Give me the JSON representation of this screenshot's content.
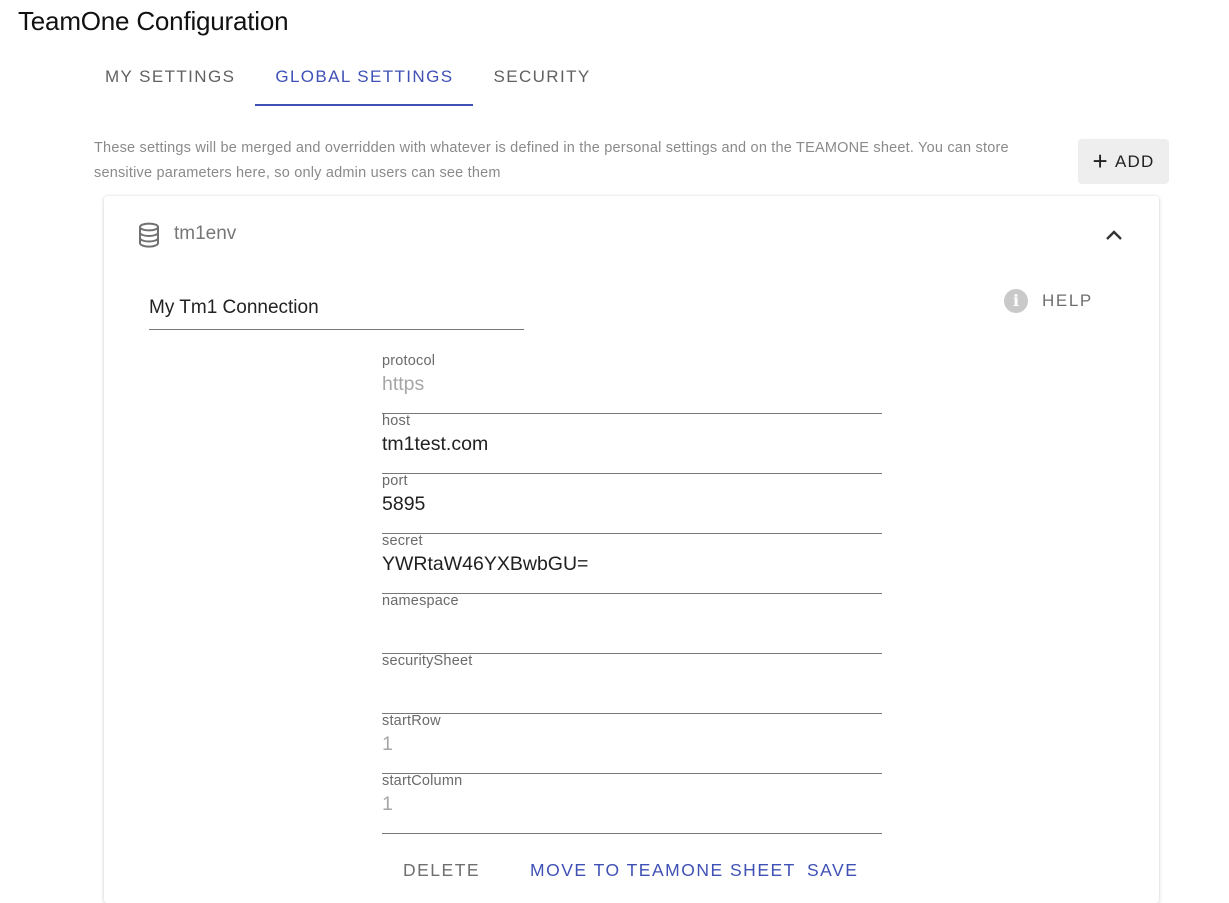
{
  "app": {
    "title": "TeamOne Configuration"
  },
  "tabs": [
    {
      "label": "MY SETTINGS",
      "active": false
    },
    {
      "label": "GLOBAL SETTINGS",
      "active": true
    },
    {
      "label": "SECURITY",
      "active": false
    }
  ],
  "description": "These settings will be merged and overridden with whatever is defined in the personal settings and on the TEAMONE sheet. You can store sensitive parameters here, so only admin users can see them",
  "toolbar": {
    "add_label": "ADD",
    "add_icon": "plus-icon"
  },
  "card": {
    "icon": "database-icon",
    "title": "tm1env",
    "expanded": true,
    "name_value": "My Tm1 Connection",
    "help_label": "HELP",
    "fields": [
      {
        "label": "protocol",
        "value": "https",
        "is_placeholder": true
      },
      {
        "label": "host",
        "value": "tm1test.com",
        "is_placeholder": false
      },
      {
        "label": "port",
        "value": "5895",
        "is_placeholder": false
      },
      {
        "label": "secret",
        "value": "YWRtaW46YXBwbGU=",
        "is_placeholder": false
      },
      {
        "label": "namespace",
        "value": "",
        "is_placeholder": false
      },
      {
        "label": "securitySheet",
        "value": "",
        "is_placeholder": false
      },
      {
        "label": "startRow",
        "value": "1",
        "is_placeholder": true
      },
      {
        "label": "startColumn",
        "value": "1",
        "is_placeholder": true
      }
    ],
    "actions": {
      "delete_label": "DELETE",
      "move_label": "MOVE TO TEAMONE SHEET",
      "save_label": "SAVE"
    }
  },
  "colors": {
    "accent": "#3f51b5",
    "muted_text": "#8a8a8a",
    "placeholder": "#a6a6a6"
  }
}
